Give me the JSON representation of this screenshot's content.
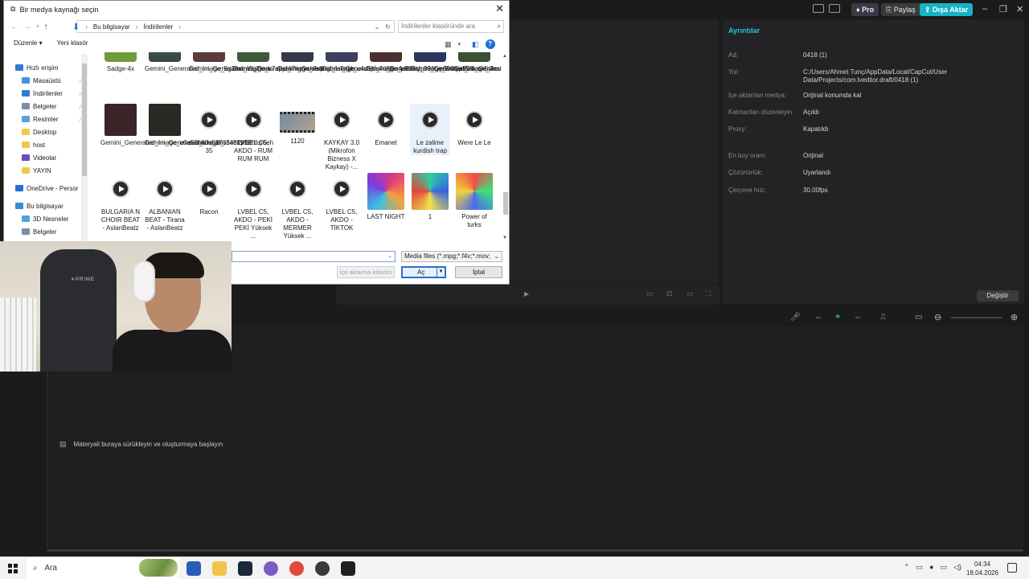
{
  "dialog": {
    "title": "Bir medya kaynağı seçin",
    "breadcrumb": [
      "Bu bilgisayar",
      "İndirilenler"
    ],
    "search_placeholder": "İndirilenler klasöründe ara",
    "toolbar": {
      "organize": "Düzenle",
      "new_folder": "Yeni klasör"
    },
    "tree": [
      {
        "label": "Hızlı erişim",
        "icon": "star-icon",
        "color": "#2f7cd3",
        "pinned": false
      },
      {
        "label": "Masaüstü",
        "icon": "desktop-folder-icon",
        "color": "#4a90e2",
        "pinned": true
      },
      {
        "label": "İndirilenler",
        "icon": "downloads-folder-icon",
        "color": "#2f7cd3",
        "pinned": true
      },
      {
        "label": "Belgeler",
        "icon": "documents-folder-icon",
        "color": "#7b8ea6",
        "pinned": true
      },
      {
        "label": "Resimler",
        "icon": "pictures-folder-icon",
        "color": "#5aa0e0",
        "pinned": true
      },
      {
        "label": "Desktop",
        "icon": "folder-icon",
        "color": "#f3c94d",
        "pinned": false
      },
      {
        "label": "host",
        "icon": "folder-icon",
        "color": "#f3c94d",
        "pinned": false
      },
      {
        "label": "Videolar",
        "icon": "videos-folder-icon",
        "color": "#6b4fb0",
        "pinned": false
      },
      {
        "label": "YAYIN",
        "icon": "folder-icon",
        "color": "#f3c94d",
        "pinned": false
      },
      {
        "label": "OneDrive - Persor",
        "icon": "cloud-icon",
        "color": "#1f6fd6",
        "pinned": false
      },
      {
        "label": "Bu bilgisayar",
        "icon": "computer-icon",
        "color": "#3a8ad8",
        "pinned": false
      },
      {
        "label": "3D Nesneler",
        "icon": "3d-objects-folder-icon",
        "color": "#4ba3e3",
        "pinned": false
      },
      {
        "label": "Belgeler",
        "icon": "documents-folder-icon",
        "color": "#7b8ea6",
        "pinned": false
      }
    ],
    "files_row1": [
      {
        "label": "Sadge-4x",
        "kind": "image",
        "color": "#6f9b3a"
      },
      {
        "label": "Gemini_Generated_Image_5g2mam5g2ma...",
        "kind": "image",
        "color": "#3c4a45"
      },
      {
        "label": "Gemini_Generated_Image_k7epyak7epyak7ep",
        "kind": "image",
        "color": "#5a3a3a"
      },
      {
        "label": "Gemini_Generated_Image_ns8ngbns8ngb...",
        "kind": "image",
        "color": "#3f5a3a"
      },
      {
        "label": "Gemini_Generated_Image_u4c8jbu4c8jbu4c8",
        "kind": "image",
        "color": "#33384a"
      },
      {
        "label": "Gemini_Generated_Image_p996typ996typ996typ996",
        "kind": "image",
        "color": "#3c3f5e"
      },
      {
        "label": "Gemini_Generated_Image_5r4con5r4con5r4c",
        "kind": "image",
        "color": "#4a3030"
      },
      {
        "label": "Gemini_Generated_Image_2mwtx02mwtx0...",
        "kind": "image",
        "color": "#2c3560"
      },
      {
        "label": "Gemini_Generated_Image_2ojanh2ojanh2oja",
        "kind": "image",
        "color": "#3a5030"
      }
    ],
    "files_row2": [
      {
        "label": "Gemini_Generated_Image_o0e58ho0e58h...",
        "kind": "image",
        "color": "#3a2428"
      },
      {
        "label": "Gemini_Generated_Image_r6ehfqr6ehfqr6eh",
        "kind": "image",
        "color": "#2a2a24"
      },
      {
        "label": "ssstik.io_1763482912 35",
        "kind": "video"
      },
      {
        "label": "LVBEL C5, AKDO - RUM RUM RUM",
        "kind": "video"
      },
      {
        "label": "1120",
        "kind": "film"
      },
      {
        "label": "KAYKAY 3.0 (Mikrofon Bizness X Kaykay) -...",
        "kind": "video"
      },
      {
        "label": "Emanet",
        "kind": "video"
      },
      {
        "label": "Le zalime kurdish trap",
        "kind": "video",
        "selected": true
      },
      {
        "label": "Were Le Le",
        "kind": "video"
      }
    ],
    "files_row3": [
      {
        "label": "BULGARIA N CHOIR BEAT - AslanBeatz",
        "kind": "video"
      },
      {
        "label": "ALBANIAN BEAT - Tirana - AslanBeatz",
        "kind": "video"
      },
      {
        "label": "Racon",
        "kind": "video"
      },
      {
        "label": "LVBEL C5, AKDO - PEKİ PEKİ Yüksek ...",
        "kind": "video"
      },
      {
        "label": "LVBEL C5, AKDO - MERMER Yüksek ...",
        "kind": "video"
      },
      {
        "label": "LVBEL C5, AKDO - TİKTOK",
        "kind": "video"
      },
      {
        "label": "LAST NIGHT",
        "kind": "art"
      },
      {
        "label": "1",
        "kind": "art"
      },
      {
        "label": "Power of turks",
        "kind": "art"
      }
    ],
    "file_type": "Media files (*.mpg;*.f4v;*.mov;",
    "import_folder": "İçe aktarma klasörü",
    "open": "Aç",
    "cancel": "İptal"
  },
  "capcut": {
    "top": {
      "pro": "Pro",
      "share": "Paylaş",
      "export": "Dışa Aktar"
    },
    "details": {
      "title": "Ayrıntılar",
      "rows": [
        {
          "label": "Ad:",
          "value": "0418 (1)"
        },
        {
          "label": "Yol:",
          "value": "C:/Users/Ahmet Tunç/AppData/Local/CapCut/User Data/Projects/com.lveditor.draft/0418 (1)"
        },
        {
          "label": "İçe aktarılan medya:",
          "value": "Orijinal konumda kal"
        },
        {
          "label": "Katmanları düzenleyin",
          "value": "Açıldı"
        },
        {
          "label": "Proxy:",
          "value": "Kapatıldı"
        },
        {
          "label": "En boy oranı:",
          "value": "Orijinal"
        },
        {
          "label": "Çözünürlük:",
          "value": "Uyarlandı"
        },
        {
          "label": "Çerçeve hızı:",
          "value": "30.00fps"
        }
      ],
      "change": "Değiştir"
    },
    "drop_hint": "Materyali buraya sürükleyin ve oluşturmaya başlayın"
  },
  "taskbar": {
    "search": "Ara",
    "time": "04:34",
    "date": "18.04.2026"
  }
}
